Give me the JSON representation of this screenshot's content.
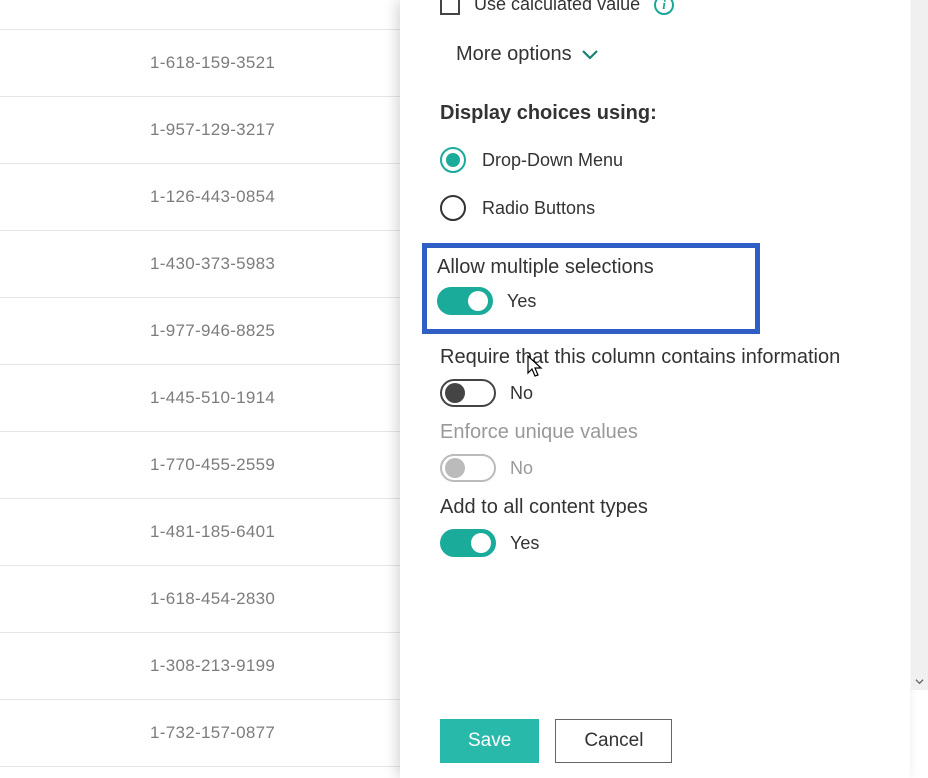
{
  "bg_rows": [
    "",
    "1-618-159-3521",
    "1-957-129-3217",
    "1-126-443-0854",
    "1-430-373-5983",
    "1-977-946-8825",
    "1-445-510-1914",
    "1-770-455-2559",
    "1-481-185-6401",
    "1-618-454-2830",
    "1-308-213-9199",
    "1-732-157-0877"
  ],
  "panel": {
    "calc_label": "Use calculated value",
    "more_options": "More options",
    "display_choices": {
      "title": "Display choices using:",
      "dropdown": "Drop-Down Menu",
      "radio": "Radio Buttons"
    },
    "allow_multi": {
      "label": "Allow multiple selections",
      "value": "Yes"
    },
    "require_info": {
      "label": "Require that this column contains information",
      "value": "No"
    },
    "enforce_unique": {
      "label": "Enforce unique values",
      "value": "No"
    },
    "add_all": {
      "label": "Add to all content types",
      "value": "Yes"
    },
    "save": "Save",
    "cancel": "Cancel"
  }
}
